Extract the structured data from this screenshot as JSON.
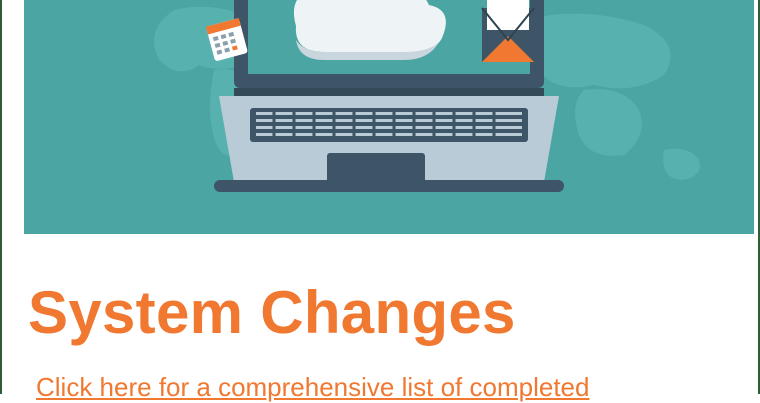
{
  "banner": {
    "icons": [
      "world-map",
      "laptop",
      "cloud",
      "calendar",
      "envelope"
    ],
    "colors": {
      "background": "#4aa5a3",
      "laptop_frame": "#3d5566",
      "laptop_body": "#b9cbd6",
      "envelope_flap": "#f07830"
    }
  },
  "section": {
    "title": "System Changes",
    "link_text": "Click here for a comprehensive list of completed"
  },
  "colors": {
    "accent": "#f07830",
    "border": "#2e5e35"
  }
}
